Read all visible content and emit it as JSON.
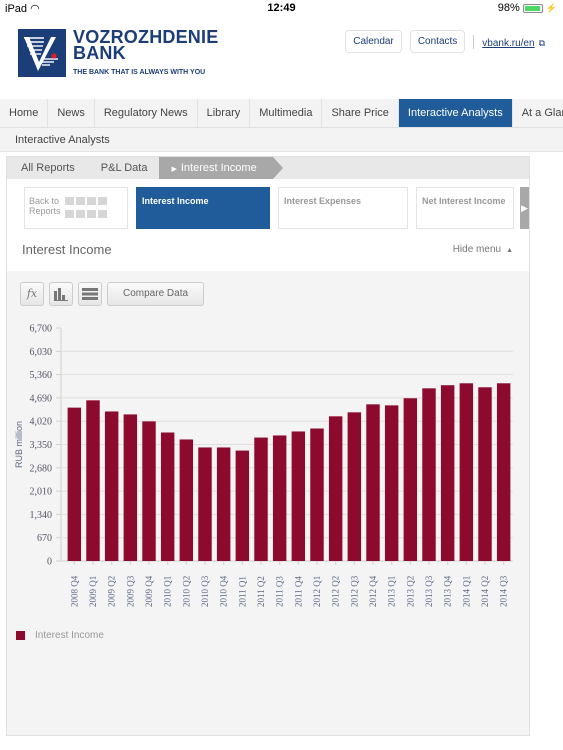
{
  "status_bar": {
    "device": "iPad",
    "time": "12:49",
    "battery": "98%",
    "battery_level": 0.98
  },
  "header": {
    "brand_line1": "VOZROZHDENIE",
    "brand_line2": "BANK",
    "tagline": "THE BANK THAT IS ALWAYS WITH YOU",
    "links": {
      "calendar": "Calendar",
      "contacts": "Contacts",
      "site": "vbank.ru/en"
    }
  },
  "nav": {
    "items": [
      "Home",
      "News",
      "Regulatory News",
      "Library",
      "Multimedia",
      "Share Price",
      "Interactive Analysts",
      "At a Glance"
    ],
    "active": "Interactive Analysts",
    "subnav": "Interactive Analysts"
  },
  "breadcrumb": {
    "items": [
      "All Reports",
      "P&L Data",
      "Interest Income"
    ]
  },
  "report_menu": {
    "back_label_line1": "Back to",
    "back_label_line2": "Reports",
    "cards": [
      "Interest Income",
      "Interest Expenses",
      "Net Interest Income"
    ],
    "active": "Interest Income"
  },
  "section": {
    "title": "Interest Income",
    "hide_menu": "Hide menu"
  },
  "toolbar": {
    "fx_label": "fx",
    "compare_label": "Compare Data"
  },
  "colors": {
    "accent": "#1f5c99",
    "bar": "#8c0a2e",
    "brand": "#1b3d78"
  },
  "chart_data": {
    "type": "bar",
    "title": "Interest Income",
    "xlabel": "",
    "ylabel": "RUB million",
    "ylim": [
      0,
      6700
    ],
    "yticks": [
      0,
      670,
      1340,
      2010,
      2680,
      3350,
      4020,
      4690,
      5360,
      6030,
      6700
    ],
    "ytick_labels": [
      "0",
      "670",
      "1,340",
      "2,010",
      "2,680",
      "3,350",
      "4,020",
      "4,690",
      "5,360",
      "6,030",
      "6,700"
    ],
    "grid": true,
    "legend_position": "bottom-left",
    "categories": [
      "2008 Q4",
      "2009 Q1",
      "2009 Q2",
      "2009 Q3",
      "2009 Q4",
      "2010 Q1",
      "2010 Q2",
      "2010 Q3",
      "2010 Q4",
      "2011 Q1",
      "2011 Q2",
      "2011 Q3",
      "2011 Q4",
      "2012 Q1",
      "2012 Q2",
      "2012 Q3",
      "2012 Q4",
      "2013 Q1",
      "2013 Q2",
      "2013 Q3",
      "2013 Q4",
      "2014 Q1",
      "2014 Q2",
      "2014 Q3"
    ],
    "series": [
      {
        "name": "Interest Income",
        "color": "#8c0a2e",
        "values": [
          4410,
          4620,
          4300,
          4215,
          4015,
          3695,
          3495,
          3265,
          3265,
          3175,
          3550,
          3610,
          3725,
          3810,
          4160,
          4275,
          4505,
          4475,
          4680,
          4965,
          5055,
          5110,
          4995,
          5110
        ]
      }
    ]
  }
}
